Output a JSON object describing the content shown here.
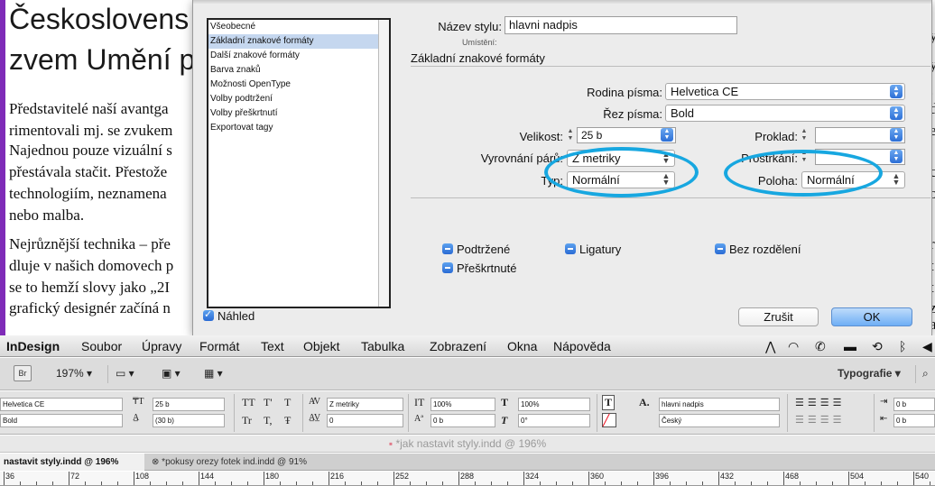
{
  "document": {
    "heading": [
      "Českoslovens",
      "zvem Umění p"
    ],
    "paragraphs": [
      "Představitelé naší avantga",
      "rimentovali mj. se zvukem",
      "Najednou pouze vizuální s",
      "přestávala stačit. Přestože",
      "technologiím, neznamena",
      "nebo malba.",
      "Nejrůznější technika – pře",
      "dluje v našich domovech p",
      "se to hemží slovy jako „2I",
      "grafický designér začíná n"
    ],
    "right_fragments": [
      "y",
      "y",
      ".",
      "d",
      "e",
      "c",
      "o",
      "r",
      "t",
      "t",
      "z",
      "a"
    ]
  },
  "dialog": {
    "categories": [
      "Všeobecné",
      "Základní znakové formáty",
      "Další znakové formáty",
      "Barva znaků",
      "Možnosti OpenType",
      "Volby podtržení",
      "Volby přeškrtnutí",
      "Exportovat tagy"
    ],
    "selected_category": "Základní znakové formáty",
    "style_name_label": "Název stylu:",
    "style_name_value": "hlavni nadpis",
    "location_label": "Umístění:",
    "section_title": "Základní znakové formáty",
    "font_family_label": "Rodina písma:",
    "font_family_value": "Helvetica CE",
    "font_style_label": "Řez písma:",
    "font_style_value": "Bold",
    "size_label": "Velikost:",
    "size_value": "25 b",
    "leading_label": "Proklad:",
    "leading_value": "",
    "kerning_label": "Vyrovnání párů:",
    "kerning_value": "Z metriky",
    "tracking_label": "Prostrkání:",
    "tracking_value": "",
    "case_label": "Typ:",
    "case_value": "Normální",
    "position_label": "Poloha:",
    "position_value": "Normální",
    "underline_label": "Podtržené",
    "ligatures_label": "Ligatury",
    "nobreak_label": "Bez rozdělení",
    "strikethrough_label": "Přeškrtnuté",
    "preview_label": "Náhled",
    "cancel_label": "Zrušit",
    "ok_label": "OK",
    "highlight_color": "#17a7e0"
  },
  "menubar": {
    "app": "InDesign",
    "items": [
      "Soubor",
      "Úpravy",
      "Formát",
      "Text",
      "Objekt",
      "Tabulka",
      "Zobrazení",
      "Okna",
      "Nápověda"
    ]
  },
  "appbar": {
    "br_badge": "Br",
    "zoom": "197% ▾",
    "workspace": "Typografie ▾"
  },
  "control_panel": {
    "font": "Helvetica CE",
    "style": "Bold",
    "size": "25 b",
    "leading": "(30 b)",
    "kerning": "Z metriky",
    "tracking": "0",
    "vscale": "100%",
    "hscale": "100%",
    "baseline": "0 b",
    "skew": "0°",
    "char_style": "hlavni nadpis",
    "language": "Český",
    "indent1": "0 b",
    "indent2": "0 b",
    "tt_glyphs": [
      "TT",
      "T'",
      "T",
      "Tr",
      "T,",
      "Ŧ"
    ]
  },
  "doc_title": "*jak nastavit styly.indd @ 196%",
  "tabs": [
    {
      "label": "nastavit styly.indd @ 196%",
      "active": true
    },
    {
      "label": "*pokusy orezy fotek ind.indd @ 91%",
      "active": false
    }
  ],
  "ruler": [
    "36",
    "72",
    "108",
    "144",
    "180",
    "216",
    "252",
    "288",
    "324",
    "360",
    "396",
    "432",
    "468",
    "504",
    "540"
  ]
}
